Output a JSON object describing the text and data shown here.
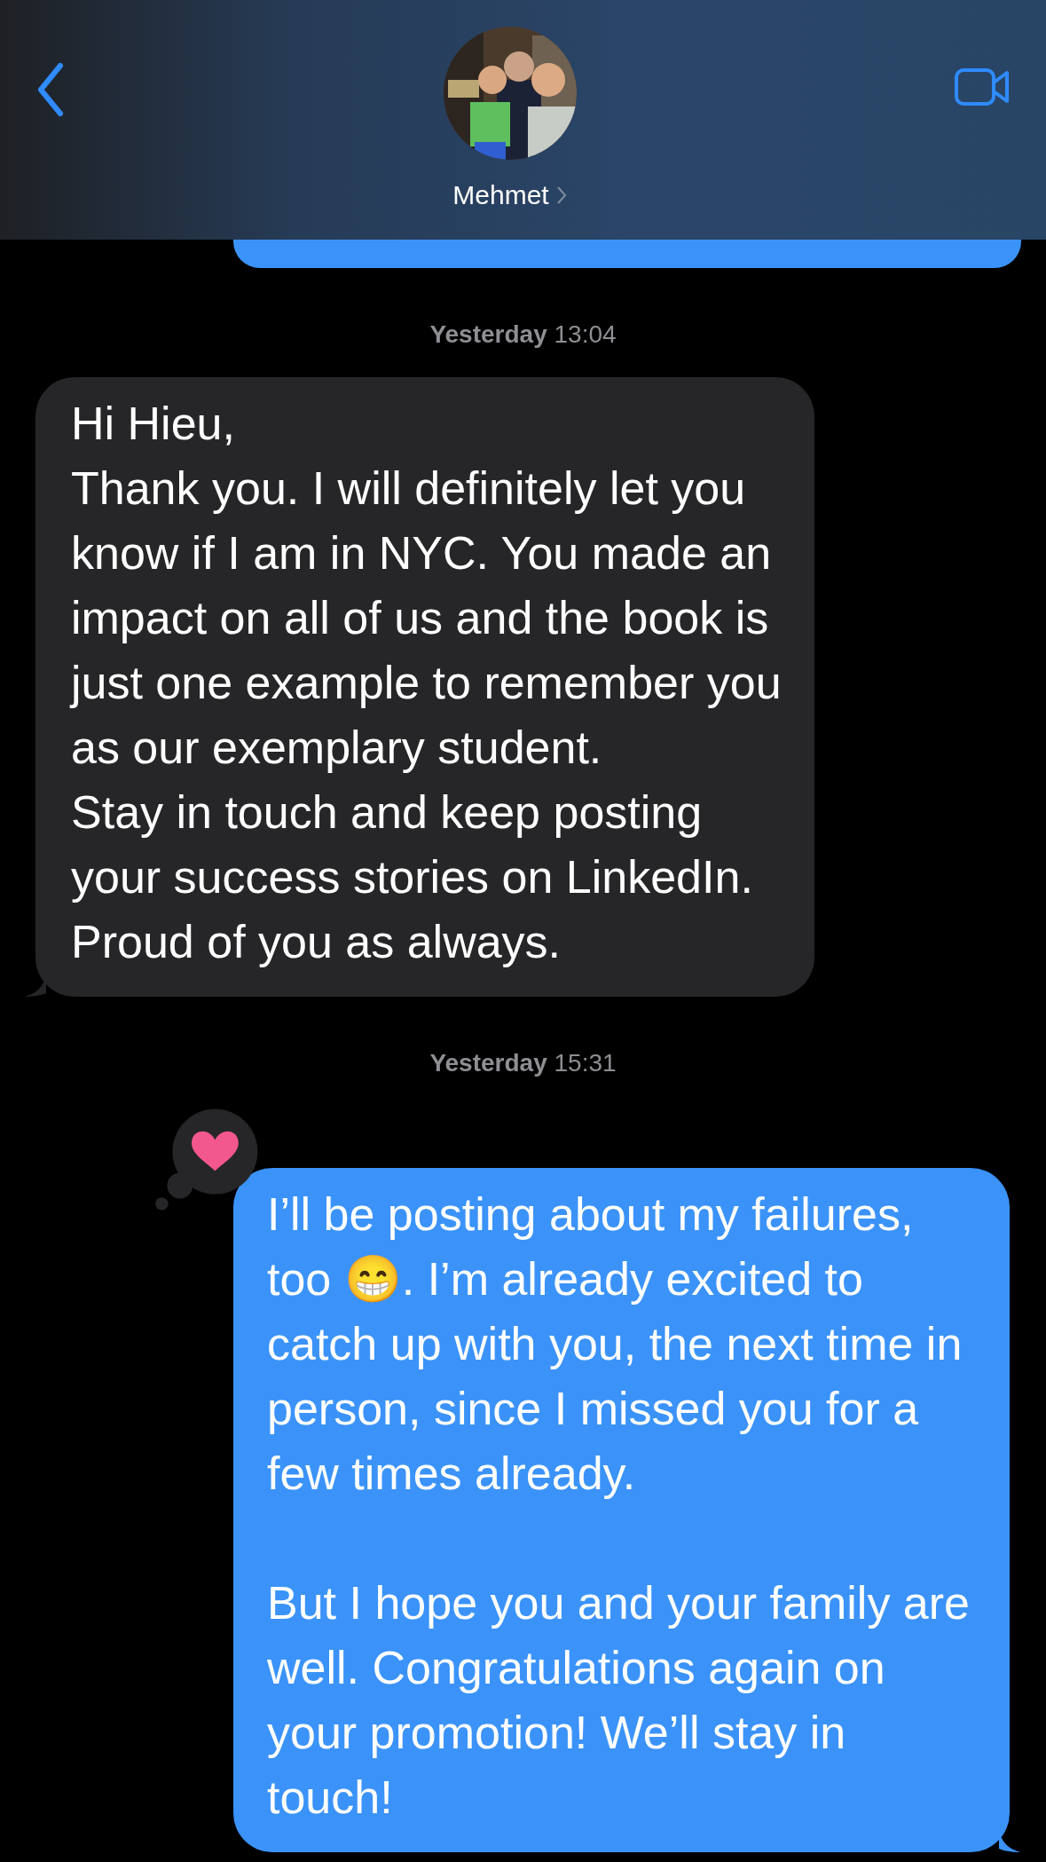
{
  "header": {
    "contact_name": "Mehmet"
  },
  "messages": [
    {
      "kind": "fragment",
      "from_me": true
    },
    {
      "kind": "timestamp",
      "text": "**Yesterday** 13:04"
    },
    {
      "kind": "message",
      "from_me": false,
      "text": "Hi Hieu,\nThank you. I will definitely let you know if I am in NYC. You made an impact on all of us and the book is just one example to remember you as our exemplary student.\nStay in touch and keep posting your success stories on LinkedIn.\nProud of you as always."
    },
    {
      "kind": "timestamp",
      "text": "**Yesterday** 15:31"
    },
    {
      "kind": "message",
      "from_me": true,
      "hearted": true,
      "text": "I’ll be posting about my failures, too 😁. I’m already excited to catch up with you, the next time in person, since I missed you for a few times already.\n\nBut I hope you and your family are well. Congratulations again on your promotion! We’ll stay in touch!"
    }
  ]
}
